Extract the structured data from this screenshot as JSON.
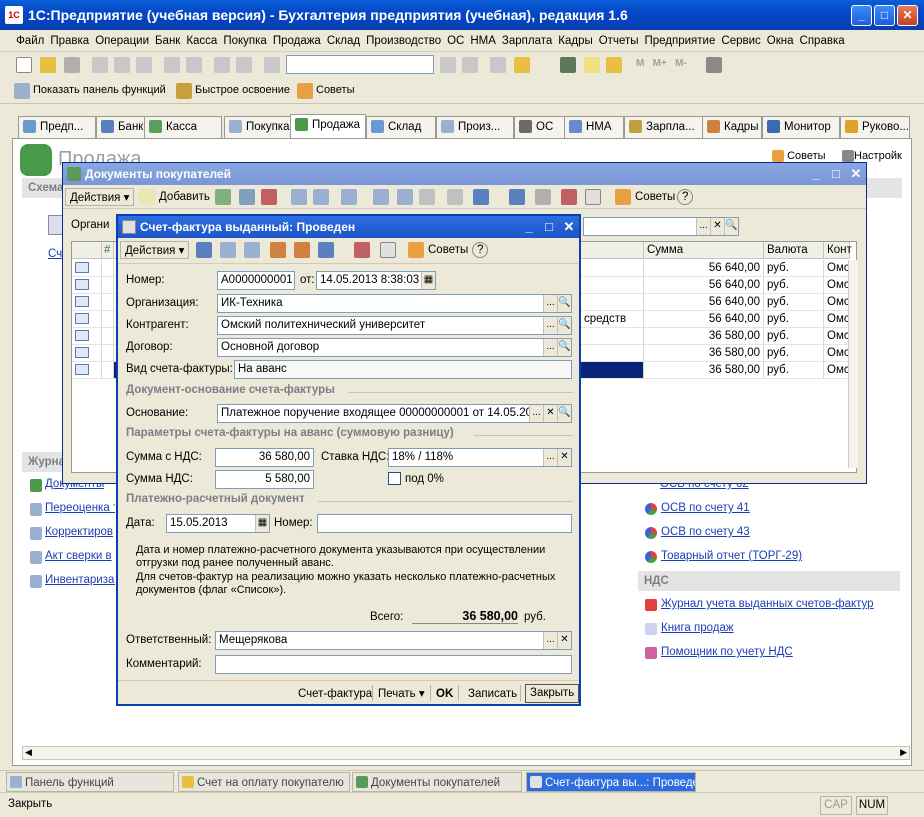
{
  "app": {
    "title": "1С:Предприятие (учебная версия) - Бухгалтерия предприятия (учебная), редакция 1.6",
    "icon_text": "1С"
  },
  "menu": [
    "Файл",
    "Правка",
    "Операции",
    "Банк",
    "Касса",
    "Покупка",
    "Продажа",
    "Склад",
    "Производство",
    "ОС",
    "НМА",
    "Зарплата",
    "Кадры",
    "Отчеты",
    "Предприятие",
    "Сервис",
    "Окна",
    "Справка"
  ],
  "toolbar2": {
    "show_panel": "Показать панель функций",
    "quick_learn": "Быстрое освоение",
    "tips": "Советы"
  },
  "tabs": [
    {
      "label": "Предп..."
    },
    {
      "label": "Банк"
    },
    {
      "label": "Касса"
    },
    {
      "label": "Покупка"
    },
    {
      "label": "Продажа",
      "active": true
    },
    {
      "label": "Склад"
    },
    {
      "label": "Произ..."
    },
    {
      "label": "ОС"
    },
    {
      "label": "НМА"
    },
    {
      "label": "Зарпла..."
    },
    {
      "label": "Кадры"
    },
    {
      "label": "Монитор"
    },
    {
      "label": "Руково..."
    }
  ],
  "panel": {
    "title": "Продажа",
    "tips": "Советы",
    "settings": "Настройк",
    "scheme_header": "Схема",
    "scheme_link": "Сч",
    "journals_header": "Журна",
    "journal_links": [
      "Документы",
      "Переоценка т",
      "Корректиров",
      "Акт сверки в",
      "Инвентаризац"
    ],
    "right_links_top": "ОСВ по счету 62",
    "right_links": [
      "ОСВ по счету 41",
      "ОСВ по счету 43",
      "Товарный отчет (ТОРГ-29)"
    ],
    "nds_header": "НДС",
    "nds_links": [
      "Журнал учета выданных счетов-фактур",
      "Книга продаж",
      "Помощник по учету НДС"
    ]
  },
  "docs_window": {
    "title": "Документы покупателей",
    "actions": "Действия",
    "add": "Добавить",
    "tips": "Советы",
    "help": "?",
    "org_label": "Органи",
    "columns": [
      "Сумма",
      "Валюта",
      "Конт"
    ],
    "rows": [
      {
        "desc": "",
        "sum": "56 640,00",
        "cur": "руб.",
        "ctr": "Омс"
      },
      {
        "desc": "",
        "sum": "56 640,00",
        "cur": "руб.",
        "ctr": "Омс"
      },
      {
        "desc": "",
        "sum": "56 640,00",
        "cur": "руб.",
        "ctr": "Омс"
      },
      {
        "desc": "средств",
        "sum": "56 640,00",
        "cur": "руб.",
        "ctr": "Омс"
      },
      {
        "desc": "",
        "sum": "36 580,00",
        "cur": "руб.",
        "ctr": "Омс"
      },
      {
        "desc": "",
        "sum": "36 580,00",
        "cur": "руб.",
        "ctr": "Омс"
      },
      {
        "desc": "",
        "sum": "36 580,00",
        "cur": "руб.",
        "ctr": "Омс"
      }
    ]
  },
  "invoice": {
    "title": "Счет-фактура выданный: Проведен",
    "actions": "Действия",
    "tips": "Советы",
    "help": "?",
    "number_label": "Номер:",
    "number": "А0000000001",
    "date_from_label": "от:",
    "datetime": "14.05.2013  8:38:03",
    "org_label": "Организация:",
    "org": "ИК-Техника",
    "contragent_label": "Контрагент:",
    "contragent": "Омский политехнический университет",
    "contract_label": "Договор:",
    "contract": "Основной договор",
    "type_label": "Вид счета-фактуры:",
    "type": "На аванс",
    "group1": "Документ-основание счета-фактуры",
    "basis_label": "Основание:",
    "basis": "Платежное поручение входящее 00000000001 от 14.05.2013",
    "group2": "Параметры счета-фактуры на аванс (суммовую разницу)",
    "sum_nds_label": "Сумма с НДС:",
    "sum_nds": "36 580,00",
    "rate_label": "Ставка НДС:",
    "rate": "18% / 118%",
    "nds_label": "Сумма НДС:",
    "nds": "5 580,00",
    "under0": "под 0%",
    "group3": "Платежно-расчетный документ",
    "pay_date_label": "Дата:",
    "pay_date": "15.05.2013",
    "pay_num_label": "Номер:",
    "pay_num": "",
    "note1": "Дата и номер платежно-расчетного документа указываются при осуществлении отгрузки под ранее полученный аванс.",
    "note2": "Для счетов-фактур на реализацию можно указать несколько платежно-расчетных документов (флаг «Список»).",
    "total_label": "Всего:",
    "total": "36 580,00",
    "currency": "руб.",
    "responsible_label": "Ответственный:",
    "responsible": "Мещерякова",
    "comment_label": "Комментарий:",
    "comment": "",
    "buttons": {
      "invoice": "Счет-фактура",
      "print": "Печать",
      "ok": "OK",
      "save": "Записать",
      "close": "Закрыть"
    }
  },
  "taskbar": [
    {
      "label": "Панель функций"
    },
    {
      "label": "Счет на оплату покупателю"
    },
    {
      "label": "Документы покупателей"
    },
    {
      "label": "Счет-фактура вы...: Проведен",
      "active": true
    }
  ],
  "status": {
    "text": "Закрыть",
    "cap": "CAP",
    "num": "NUM"
  }
}
